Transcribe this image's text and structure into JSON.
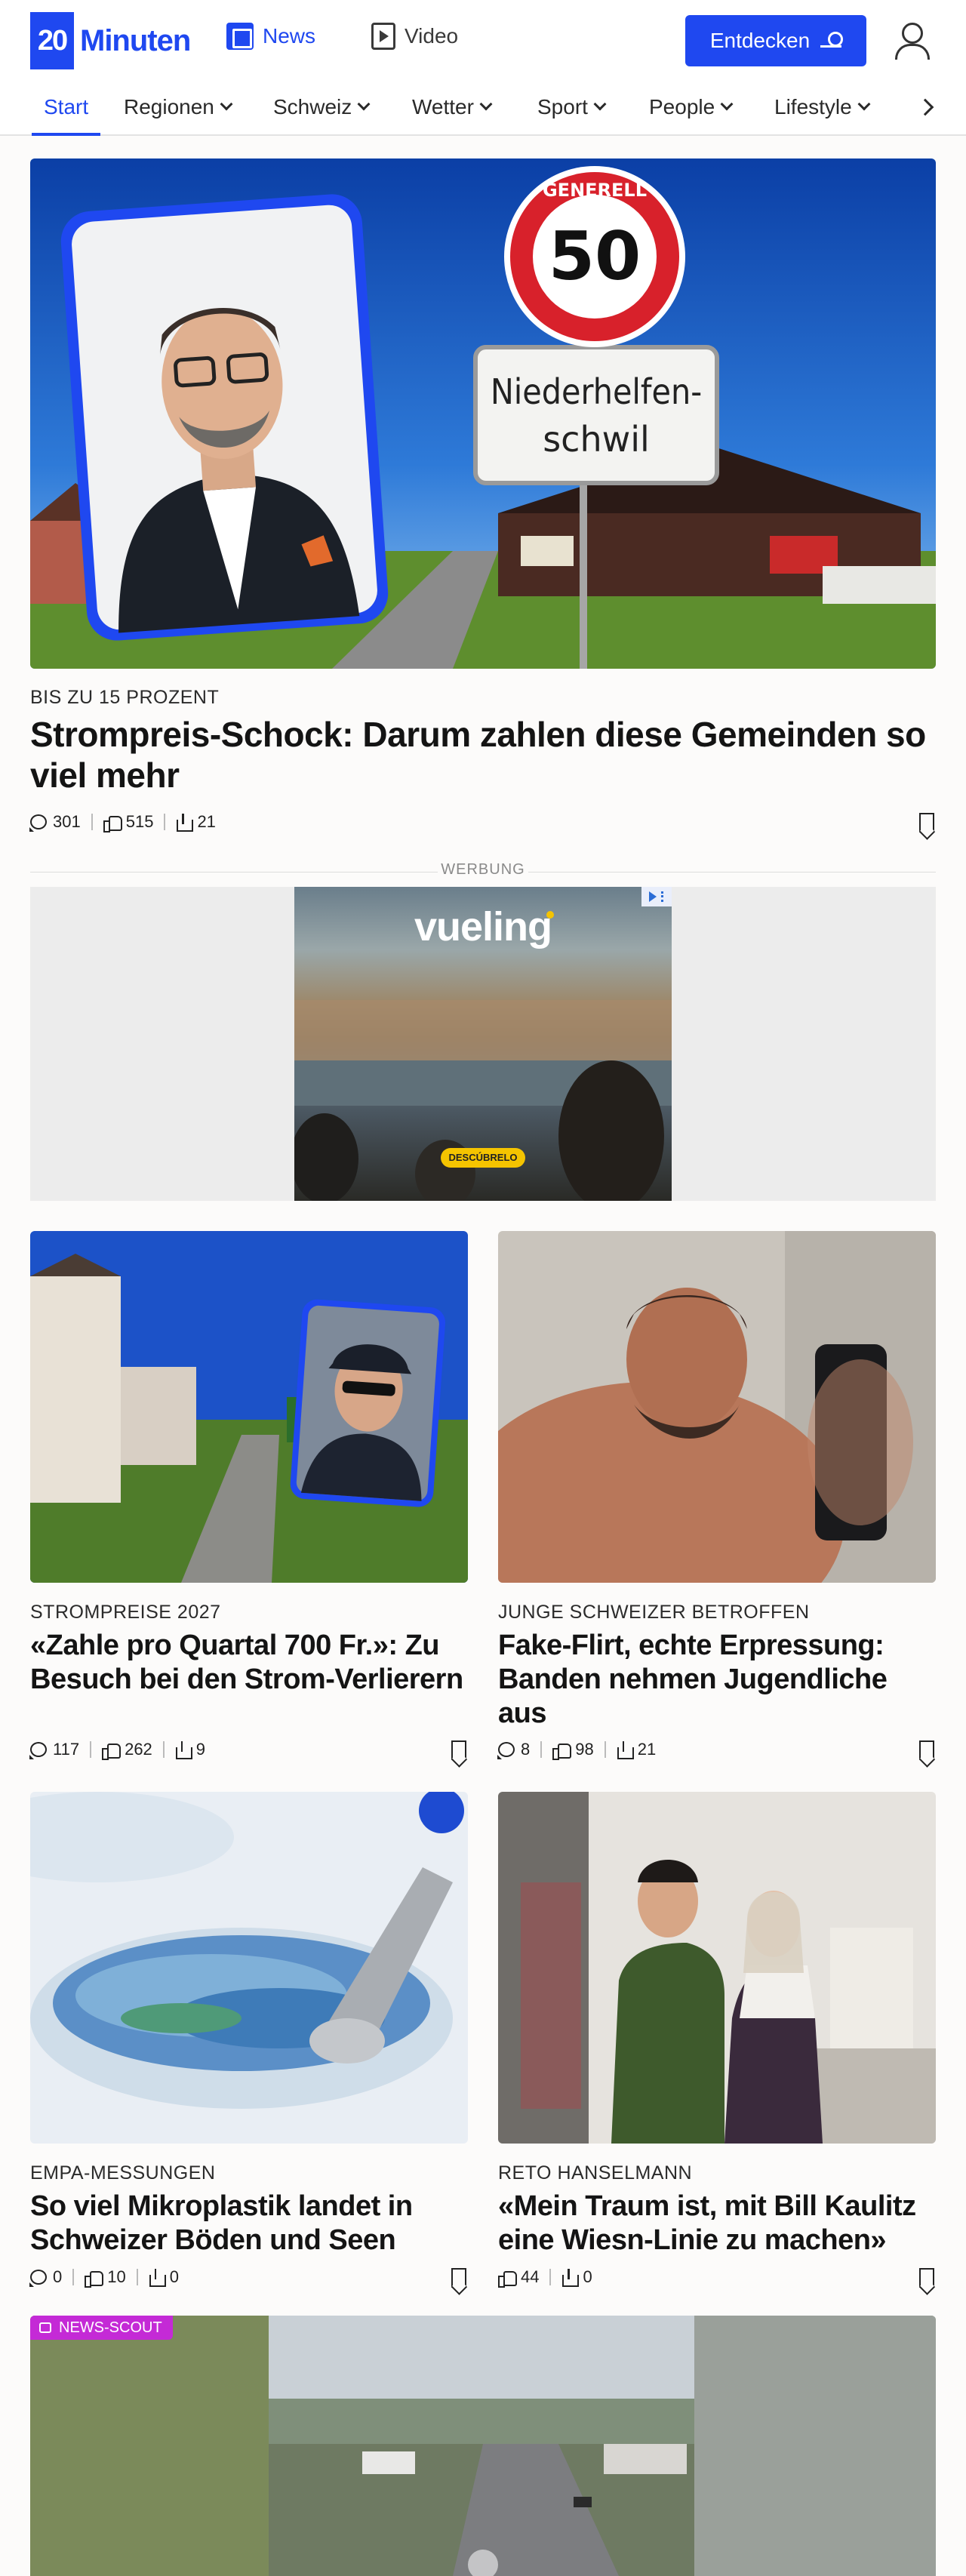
{
  "header": {
    "logo_text": "Minuten",
    "logo_mark": "20",
    "nav_news": "News",
    "nav_video": "Video",
    "discover_button": "Entdecken"
  },
  "subnav": {
    "items": [
      {
        "label": "Start"
      },
      {
        "label": "Regionen"
      },
      {
        "label": "Schweiz"
      },
      {
        "label": "Wetter"
      },
      {
        "label": "Sport"
      },
      {
        "label": "People"
      },
      {
        "label": "Lifestyle"
      }
    ]
  },
  "hero": {
    "kicker": "BIS ZU 15 PROZENT",
    "headline": "Strompreis-Schock: Darum zahlen diese Gemeinden so viel mehr",
    "sign_speed": "50",
    "sign_top": "GENERELL",
    "sign_town_1": "Niederhelfen-",
    "sign_town_2": "schwil",
    "comments": "301",
    "likes": "515",
    "shares": "21"
  },
  "ad": {
    "label": "WERBUNG",
    "brand": "vueling",
    "cta": "DESCÚBRELO"
  },
  "articles": [
    {
      "kicker": "STROMPREISE 2027",
      "headline": "«Zahle pro Quartal 700 Fr.»: Zu Besuch bei den Strom-Verlierern",
      "comments": "117",
      "likes": "262",
      "shares": "9"
    },
    {
      "kicker": "JUNGE SCHWEIZER BETROFFEN",
      "headline": "Fake-Flirt, echte Erpressung: Banden nehmen Jugendliche aus",
      "comments": "8",
      "likes": "98",
      "shares": "21"
    },
    {
      "kicker": "EMPA-MESSUNGEN",
      "headline": "So viel Mikroplastik landet in Schweizer Böden und Seen",
      "comments": "0",
      "likes": "10",
      "shares": "0"
    },
    {
      "kicker": "RETO HANSELMANN",
      "headline": "«Mein Traum ist, mit Bill Kaulitz eine Wiesn-Linie zu machen»",
      "likes": "44",
      "shares": "0"
    }
  ],
  "video_teaser": {
    "badge": "NEWS-SCOUT"
  },
  "colors": {
    "brand_blue": "#1f48f0",
    "badge_magenta": "#c42ad6",
    "ad_yellow": "#f5c400"
  }
}
